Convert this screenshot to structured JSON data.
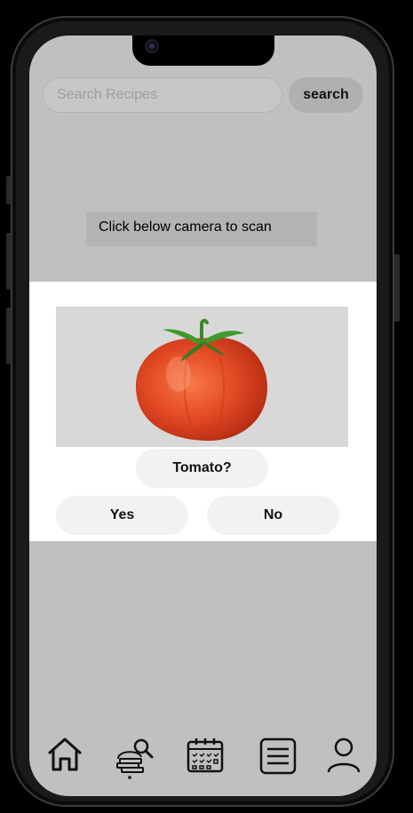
{
  "search": {
    "placeholder": "Search Recipes",
    "button_label": "search"
  },
  "scan_hint": "Click below camera to scan",
  "dialog": {
    "image_subject": "tomato",
    "question": "Tomato?",
    "yes_label": "Yes",
    "no_label": "No"
  },
  "bottom_nav": {
    "items": [
      {
        "icon": "home-icon"
      },
      {
        "icon": "recipe-search-icon",
        "active": true
      },
      {
        "icon": "calendar-icon"
      },
      {
        "icon": "list-icon"
      },
      {
        "icon": "profile-icon"
      }
    ]
  },
  "colors": {
    "background": "#c0c0c0",
    "dialog": "#ffffff",
    "pill": "#f2f2f2"
  }
}
